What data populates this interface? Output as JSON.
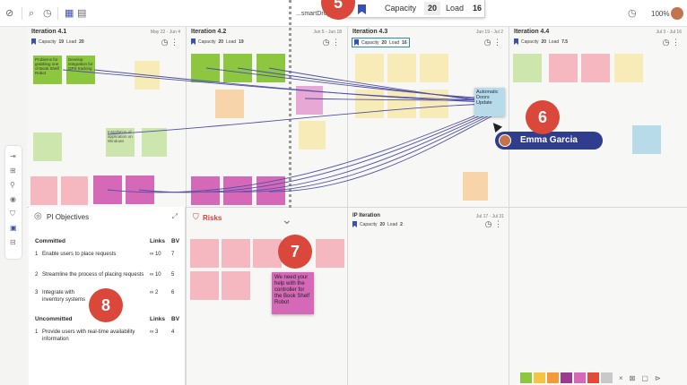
{
  "topbar": {
    "breadcrumb": "...smartDrops",
    "zoom": "100%"
  },
  "columns": [
    {
      "title": "Iteration 4.1",
      "date": "May 22 - Jun 4",
      "capacity_label": "Capacity",
      "capacity": "19",
      "load_label": "Load",
      "load": "20"
    },
    {
      "title": "Iteration 4.2",
      "date": "Jun 5 - Jun 18",
      "capacity_label": "Capacity",
      "capacity": "20",
      "load_label": "Load",
      "load": "19"
    },
    {
      "title": "Iteration 4.3",
      "date": "Jun 19 - Jul 2",
      "capacity_label": "Capacity",
      "capacity": "20",
      "load_label": "Load",
      "load": "16"
    },
    {
      "title": "Iteration 4.4",
      "date": "Jul 3 - Jul 16",
      "capacity_label": "Capacity",
      "capacity": "20",
      "load_label": "Load",
      "load": "7.5"
    }
  ],
  "ip_iteration": {
    "title": "IP Iteration",
    "date": "Jul 17 - Jul 31",
    "capacity_label": "Capacity",
    "capacity": "20",
    "load_label": "Load",
    "load": "2"
  },
  "tooltip": {
    "capacity_label": "Capacity",
    "capacity": "20",
    "load_label": "Load",
    "load": "16"
  },
  "stickies": {
    "s1": "Problems for grabbing one of Book Shelf Robot",
    "s2": "Develop integration for GPS tracking",
    "s3": "Installation of application on Windows"
  },
  "focus_note": "Automatic Doors Update",
  "user_tag": "Emma Garcia",
  "big_note": "We need your help with the controller for the Book Shelf Robot",
  "badges": [
    "5",
    "6",
    "7",
    "8"
  ],
  "objectives": {
    "title": "PI Objectives",
    "committed_label": "Committed",
    "uncommitted_label": "Uncommitted",
    "links_label": "Links",
    "bv_label": "BV",
    "committed": [
      {
        "n": "1",
        "text": "Enable users to place requests",
        "links": "∞ 10",
        "bv": "7"
      },
      {
        "n": "2",
        "text": "Streamline the process of placing requests",
        "links": "∞ 10",
        "bv": "5"
      },
      {
        "n": "3",
        "text": "Integrate with inventory systems",
        "links": "∞ 2",
        "bv": "6"
      }
    ],
    "uncommitted": [
      {
        "n": "1",
        "text": "Provide users with real-time availability information",
        "links": "∞ 3",
        "bv": "4"
      }
    ]
  },
  "risks": {
    "title": "Risks"
  },
  "palette": [
    "#8dc63f",
    "#f6c445",
    "#f39a3c",
    "#9a3b8e",
    "#d569b8",
    "#e24b3a",
    "#c9c9c9"
  ]
}
